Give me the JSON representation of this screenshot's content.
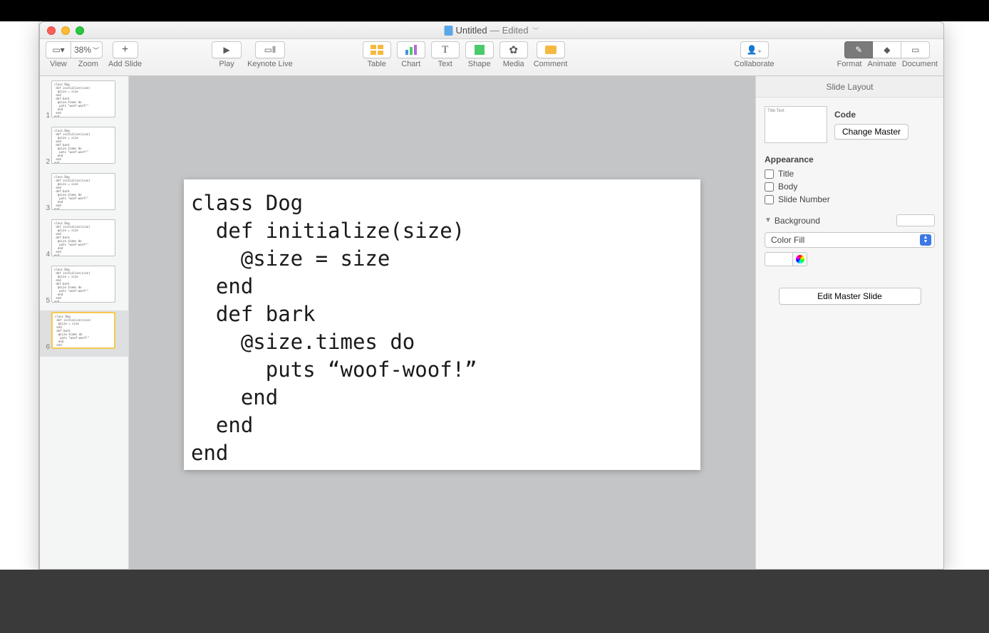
{
  "window": {
    "title": "Untitled",
    "status": "Edited"
  },
  "toolbar": {
    "view": "View",
    "zoom_level": "38%",
    "zoom": "Zoom",
    "add_slide": "Add Slide",
    "play": "Play",
    "keynote_live": "Keynote Live",
    "table": "Table",
    "chart": "Chart",
    "text": "Text",
    "shape": "Shape",
    "media": "Media",
    "comment": "Comment",
    "collaborate": "Collaborate",
    "format": "Format",
    "animate": "Animate",
    "document": "Document"
  },
  "navigator": {
    "thumb_code": "class Dog\n def initialize(size)\n  @size = size\n end\n def bark\n  @size.times do\n   puts \"woof-woof!\"\n  end\n end\nend",
    "slides": [
      1,
      2,
      3,
      4,
      5,
      6
    ],
    "selected": 6
  },
  "slide": {
    "code": "class Dog\n  def initialize(size)\n    @size = size\n  end\n  def bark\n    @size.times do\n      puts “woof-woof!”\n    end\n  end\nend"
  },
  "inspector": {
    "header": "Slide Layout",
    "master_preview_label": "Title Text",
    "master_name": "Code",
    "change_master": "Change Master",
    "appearance": "Appearance",
    "title": "Title",
    "body": "Body",
    "slide_number": "Slide Number",
    "background": "Background",
    "fill_type": "Color Fill",
    "edit_master": "Edit Master Slide"
  }
}
